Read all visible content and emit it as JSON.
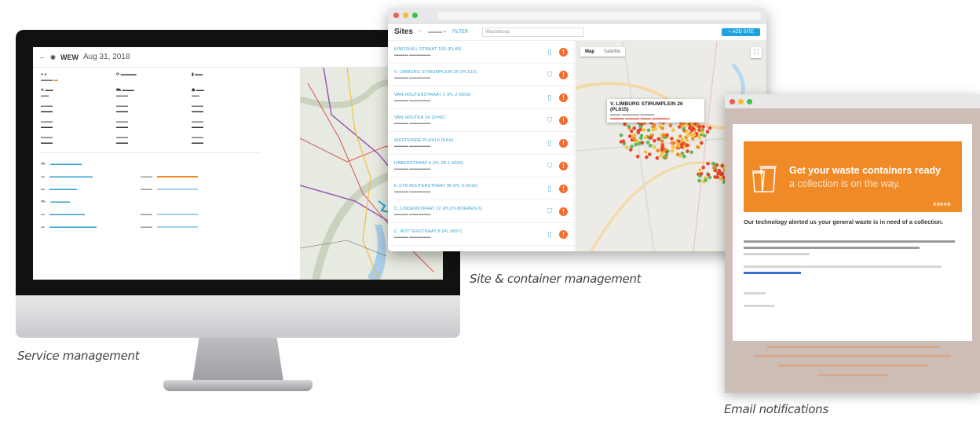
{
  "captions": {
    "service": "Service management",
    "sites": "Site & container management",
    "email": "Email notifications"
  },
  "service_app": {
    "title": "WEW",
    "date": "Aug 31, 2018",
    "muted_text": "..."
  },
  "sites_app": {
    "title": "Sites",
    "filter_label": "FILTER",
    "search_placeholder": "Wachtwoup",
    "add_button": "+ ADD SITE",
    "map_tabs": [
      "Map",
      "Satellite"
    ],
    "popup": {
      "title": "V. LIMBURG STIRUMPLEIN 26 (PL615)"
    },
    "items": [
      {
        "name": "KINGSHILL STRAAT 105 (PL40)"
      },
      {
        "name": "V. LIMBURG STIRUMPLEIN 26 (PL615)"
      },
      {
        "name": "VAN HOUTENSTRAAT 2 (PL 2-6593)"
      },
      {
        "name": "VAN HOUTEN 24 (2042)"
      },
      {
        "name": "WESTEINDE PLEIN 6 (KAS)"
      },
      {
        "name": "HABERSTRAAT 6 (PL 28 1 4203)"
      },
      {
        "name": "K-STR ACHTERSTRAAT 36 (PL 3-0615)"
      },
      {
        "name": "C. LINDENSTRAAT 12 (PLOV-BOEREN 6)"
      },
      {
        "name": "C. ROTTERSTRAAT 8 (PL 8657)"
      }
    ]
  },
  "email": {
    "headline": "Get your waste containers ready",
    "subline": "a collection is on the way.",
    "logo": "enevo",
    "intro": "Our technology alerted us your general waste is in need of a collection."
  },
  "colors": {
    "accent_orange": "#f08a27",
    "alert_orange": "#f26a2c",
    "link_blue": "#2f9fd0",
    "button_blue": "#1ea2dc"
  }
}
